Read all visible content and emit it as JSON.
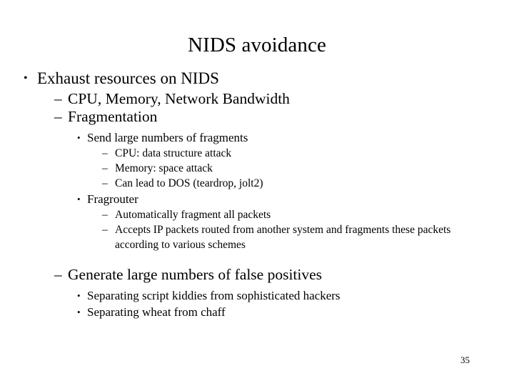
{
  "slide": {
    "title": "NIDS avoidance",
    "page_number": "35",
    "background_color": "#ffffff",
    "text_color": "#000000",
    "markers": {
      "level1": "•",
      "level2": "–",
      "level3": "•",
      "level4": "–"
    },
    "outline": [
      {
        "level": 1,
        "text": "Exhaust resources on NIDS"
      },
      {
        "level": 2,
        "text": "CPU, Memory, Network Bandwidth"
      },
      {
        "level": 2,
        "text": "Fragmentation"
      },
      {
        "level": 3,
        "text": "Send large numbers of fragments"
      },
      {
        "level": 4,
        "text": "CPU: data structure attack"
      },
      {
        "level": 4,
        "text": "Memory: space attack"
      },
      {
        "level": 4,
        "text": "Can lead to DOS (teardrop, jolt2)"
      },
      {
        "level": 3,
        "text": "Fragrouter"
      },
      {
        "level": 4,
        "text": "Automatically fragment all packets"
      },
      {
        "level": 4,
        "text": "Accepts IP packets routed from another system and fragments these packets according to various schemes"
      },
      {
        "level": 2,
        "text": "Generate large numbers of false positives"
      },
      {
        "level": 3,
        "text": "Separating script kiddies from sophisticated hackers"
      },
      {
        "level": 3,
        "text": "Separating wheat from chaff"
      }
    ]
  }
}
